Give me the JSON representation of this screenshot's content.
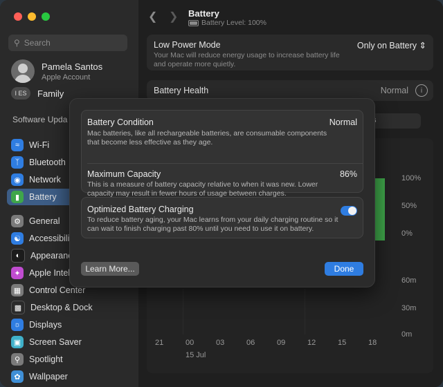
{
  "sidebar": {
    "search_placeholder": "Search",
    "user": {
      "name": "Pamela Santos",
      "subtitle": "Apple Account"
    },
    "family": {
      "badge": "I ES",
      "label": "Family"
    },
    "software_update": "Software Upda",
    "items_top": [
      {
        "label": "Wi-Fi",
        "icon": "wifi-icon",
        "color": "#2f7de1"
      },
      {
        "label": "Bluetooth",
        "icon": "bluetooth-icon",
        "color": "#2f7de1"
      },
      {
        "label": "Network",
        "icon": "network-icon",
        "color": "#2f7de1"
      },
      {
        "label": "Battery",
        "icon": "battery-icon",
        "color": "#3fa64a",
        "selected": true
      }
    ],
    "items_bottom": [
      {
        "label": "General",
        "icon": "gear-icon",
        "color": "#7a7a7a"
      },
      {
        "label": "Accessibili",
        "icon": "accessibility-icon",
        "color": "#2f7de1"
      },
      {
        "label": "Appearanc",
        "icon": "appearance-icon",
        "color": "#1c1c1c"
      },
      {
        "label": "Apple Intell",
        "icon": "apple-intelligence-icon",
        "color": "#c04cd0"
      },
      {
        "label": "Control Center",
        "icon": "control-center-icon",
        "color": "#7a7a7a"
      },
      {
        "label": "Desktop & Dock",
        "icon": "dock-icon",
        "color": "#2a2a2a"
      },
      {
        "label": "Displays",
        "icon": "display-icon",
        "color": "#2f7de1"
      },
      {
        "label": "Screen Saver",
        "icon": "screen-saver-icon",
        "color": "#3fb0c9"
      },
      {
        "label": "Spotlight",
        "icon": "spotlight-icon",
        "color": "#7a7a7a"
      },
      {
        "label": "Wallpaper",
        "icon": "wallpaper-icon",
        "color": "#3f8fd6"
      }
    ]
  },
  "content": {
    "title": "Battery",
    "subtitle": "Battery Level: 100%",
    "low_power": {
      "title": "Low Power Mode",
      "desc": "Your Mac will reduce energy usage to increase battery life and operate more quietly.",
      "value": "Only on Battery"
    },
    "battery_health": {
      "title": "Battery Health",
      "value": "Normal"
    },
    "segment_label": "s",
    "chart_y_top": [
      "100%",
      "50%",
      "0%"
    ],
    "chart_y_bottom": [
      "60m",
      "30m",
      "0m"
    ],
    "chart_x": [
      "21",
      "00",
      "03",
      "06",
      "09",
      "12",
      "15",
      "18"
    ],
    "chart_date": "15 Jul",
    "chart_partial": "8"
  },
  "dialog": {
    "condition": {
      "title": "Battery Condition",
      "value": "Normal",
      "desc": "Mac batteries, like all rechargeable batteries, are consumable components that become less effective as they age."
    },
    "capacity": {
      "title": "Maximum Capacity",
      "value": "86%",
      "desc": "This is a measure of battery capacity relative to when it was new. Lower capacity may result in fewer hours of usage between charges."
    },
    "optimized": {
      "title": "Optimized Battery Charging",
      "desc": "To reduce battery aging, your Mac learns from your daily charging routine so it can wait to finish charging past 80% until you need to use it on battery.",
      "enabled": true
    },
    "learn_more": "Learn More...",
    "done": "Done"
  },
  "colors": {
    "accent": "#2f7de1",
    "selected_sidebar": "#3d5d86",
    "battery_green": "#3fa64a"
  }
}
